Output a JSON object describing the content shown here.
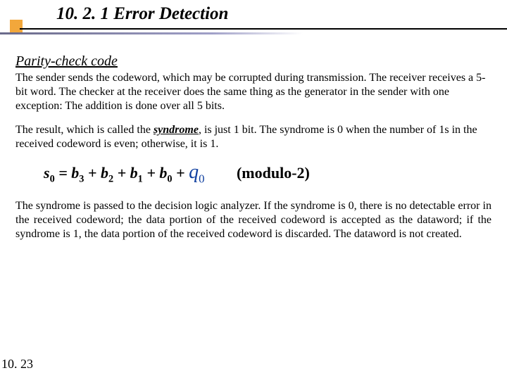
{
  "heading": "10. 2. 1 Error Detection",
  "subtitle": "Parity-check code",
  "para1": "The sender sends the codeword, which may be corrupted during transmission. The receiver receives a 5-bit word. The checker at the receiver does the same thing as the generator in the sender with one exception: The addition is done over all 5 bits.",
  "para2_a": "The result, which is called the ",
  "syndrome_word": "syndrome",
  "para2_b": ", is just 1 bit. The syndrome is 0 when the number of 1s in the received codeword is even; otherwise, it is 1.",
  "formula": {
    "s": "s",
    "s_sub": "0",
    "eq": " = ",
    "b": "b",
    "b3": "3",
    "b2": "2",
    "b1": "1",
    "b0": "0",
    "plus": " + ",
    "q": "q",
    "q_sub": "0",
    "mod": "(modulo-2)"
  },
  "para3": "The syndrome is passed to the decision logic analyzer. If the syndrome is 0, there is no detectable error in the received codeword; the data portion of the received codeword is accepted as the dataword; if the syndrome is 1, the data portion of the received codeword is discarded. The dataword is not created.",
  "page_number": "10. 23"
}
